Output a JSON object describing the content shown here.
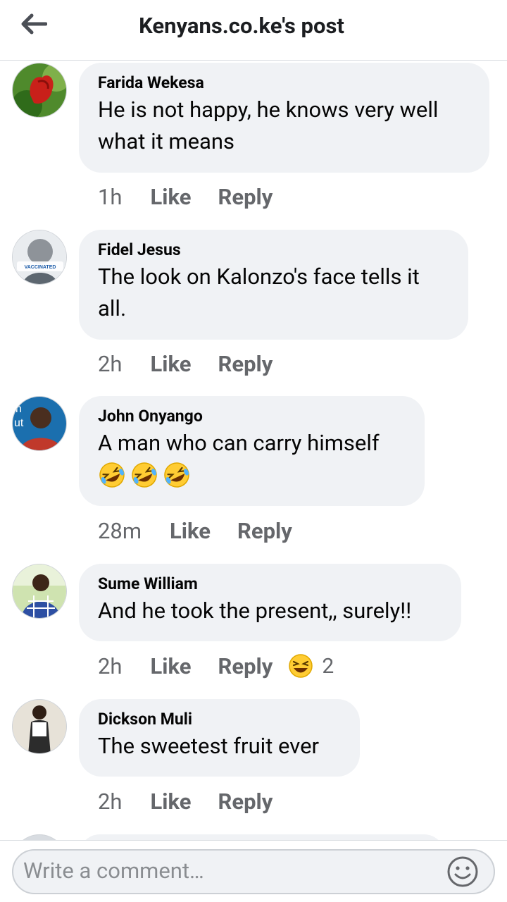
{
  "header": {
    "title": "Kenyans.co.ke's post",
    "back_icon": "back-arrow-icon"
  },
  "comments": [
    {
      "author": "Farida Wekesa",
      "text": "He is not happy, he knows very well what it means",
      "time": "1h",
      "like": "Like",
      "reply": "Reply"
    },
    {
      "author": "Fidel Jesus",
      "text": "The look on Kalonzo's face tells it all.",
      "time": "2h",
      "like": "Like",
      "reply": "Reply",
      "avatar_badge": "VACCINATED"
    },
    {
      "author": "John Onyango",
      "text": "A man who can carry himself",
      "emoji": [
        "rolling-on-floor-laughing-emoji",
        "rolling-on-floor-laughing-emoji",
        "rolling-on-floor-laughing-emoji"
      ],
      "time": "28m",
      "like": "Like",
      "reply": "Reply"
    },
    {
      "author": "Sume William",
      "text": "And he took the present,, surely!!",
      "time": "2h",
      "like": "Like",
      "reply": "Reply",
      "reaction_icon": "laughing-reaction-icon",
      "reaction_count": "2"
    },
    {
      "author": "Dickson Muli",
      "text": "The sweetest fruit ever",
      "time": "2h",
      "like": "Like",
      "reply": "Reply"
    }
  ],
  "composer": {
    "placeholder": "Write a comment…",
    "emoji_icon": "smiley-icon"
  },
  "colors": {
    "bubble": "#f0f2f5",
    "secondary_text": "#65676b",
    "divider": "#dadde1"
  }
}
